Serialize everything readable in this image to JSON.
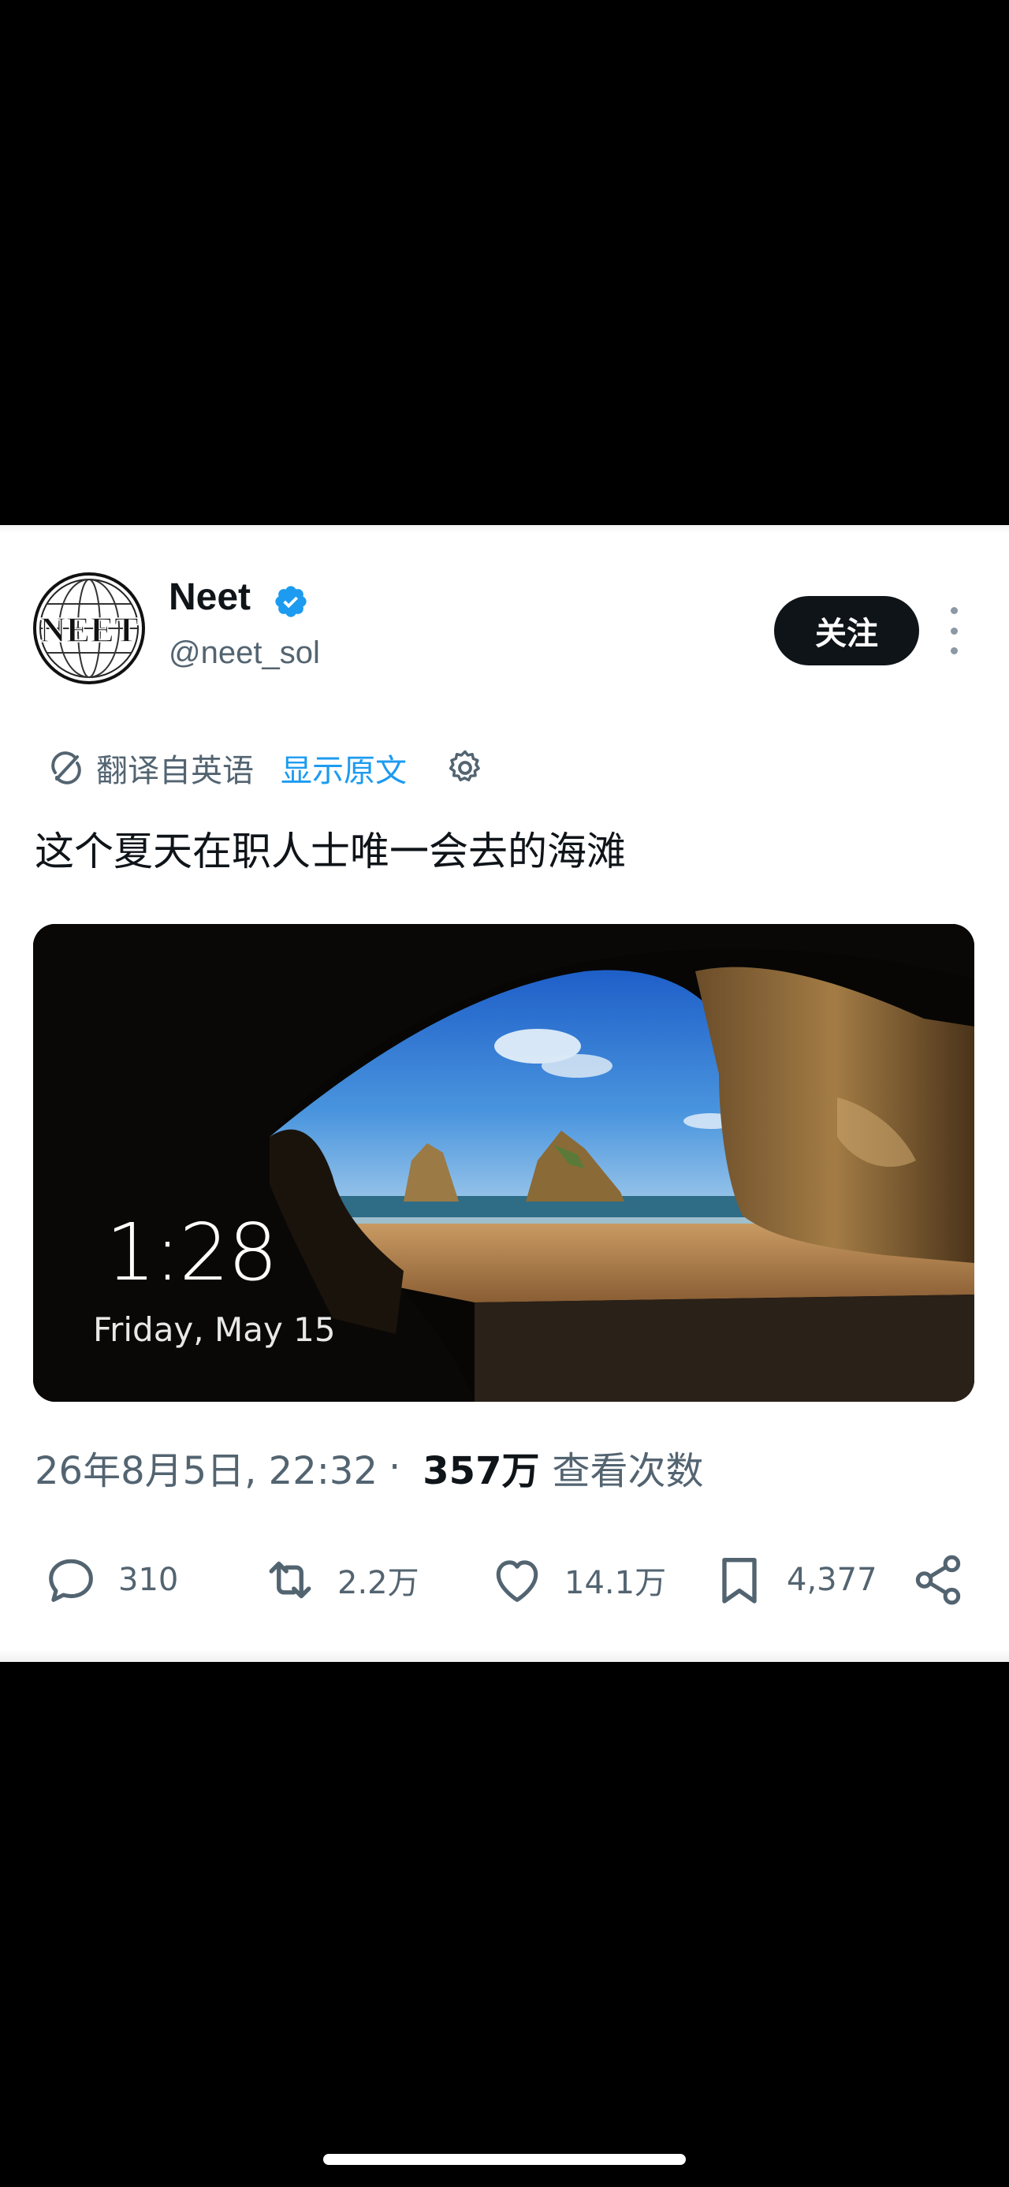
{
  "tweet": {
    "display_name": "Neet",
    "handle": "@neet_sol",
    "avatar_text": "NEET",
    "follow_label": "关注",
    "translated_label": "翻译自英语",
    "show_original_label": "显示原文",
    "text": "这个夏天在职人士唯一会去的海滩",
    "media": {
      "lock_time": "1:28",
      "lock_date": "Friday, May 15"
    },
    "timestamp": "26年8月5日, 22:32",
    "separator": "·",
    "views_count": "357万",
    "views_label": "查看次数",
    "actions": {
      "replies": "310",
      "reposts": "2.2万",
      "likes": "14.1万",
      "bookmarks": "4,377"
    }
  },
  "colors": {
    "background": "#000000",
    "card": "#ffffff",
    "text_primary": "#0f1419",
    "text_secondary": "#536471",
    "accent_blue": "#1d9bf0",
    "verified": "#1d9bf0"
  },
  "icons": {
    "verified": "verified-badge-icon",
    "translate": "translate-icon",
    "settings": "gear-icon",
    "more": "more-vertical-icon",
    "reply": "reply-icon",
    "repost": "repost-icon",
    "like": "heart-icon",
    "bookmark": "bookmark-icon",
    "share": "share-icon"
  }
}
